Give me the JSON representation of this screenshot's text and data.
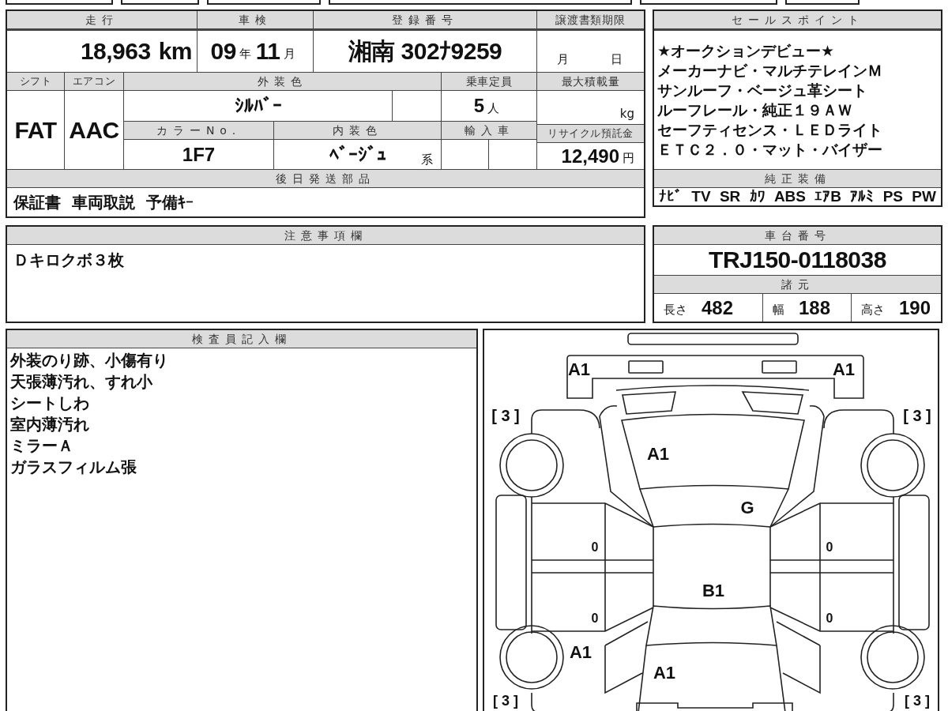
{
  "mileage": {
    "label": "走行",
    "value": "18,963",
    "unit": "km"
  },
  "inspection": {
    "label": "車検",
    "year": "09",
    "year_unit": "年",
    "month": "11",
    "month_unit": "月"
  },
  "registration": {
    "label": "登録番号",
    "value": "湘南 302ﾅ9259"
  },
  "transfer_deadline": {
    "label": "譲渡書類期限",
    "month_unit": "月",
    "day_unit": "日"
  },
  "shift": {
    "label": "シフト",
    "value": "FAT"
  },
  "aircon": {
    "label": "エアコン",
    "value": "AAC"
  },
  "exterior_color": {
    "label": "外装色",
    "value": "ｼﾙﾊﾞｰ"
  },
  "color_no": {
    "label": "カラーNo.",
    "value": "1F7"
  },
  "interior_color": {
    "label": "内装色",
    "value": "ﾍﾞｰｼﾞｭ",
    "suffix": "系"
  },
  "capacity": {
    "label": "乗車定員",
    "value": "5",
    "unit": "人"
  },
  "max_load": {
    "label": "最大積載量",
    "unit": "kg"
  },
  "import": {
    "label": "輸入車"
  },
  "recycle": {
    "label": "リサイクル預託金",
    "value": "12,490",
    "unit": "円"
  },
  "later_parts": {
    "label": "後日発送部品",
    "items": [
      "保証書",
      "車両取説",
      "予備ｷｰ"
    ]
  },
  "sales_points": {
    "label": "セールスポイント",
    "lines": [
      "★オークションデビュー★",
      "メーカーナビ・マルチテレインＭ",
      "サンルーフ・ベージュ革シート",
      "ルーフレール・純正１９ＡＷ",
      "セーフティセンス・ＬＥＤライト",
      "ＥＴＣ２．０・マット・バイザー"
    ]
  },
  "genuine_equipment": {
    "label": "純正装備",
    "items": [
      "ﾅﾋﾞ",
      "TV",
      "SR",
      "ｶﾜ",
      "ABS",
      "ｴｱB",
      "ｱﾙﾐ",
      "PS",
      "PW"
    ]
  },
  "notes": {
    "label": "注意事項欄",
    "text": "Ｄキロクボ３枚"
  },
  "chassis": {
    "label": "車台番号",
    "value": "TRJ150-0118038"
  },
  "specs": {
    "label": "諸元",
    "items": [
      {
        "label": "長さ",
        "value": "482"
      },
      {
        "label": "幅",
        "value": "188"
      },
      {
        "label": "高さ",
        "value": "190"
      }
    ]
  },
  "inspector": {
    "label": "検査員記入欄",
    "lines": [
      "外装のり跡、小傷有り",
      "天張薄汚れ、すれ小",
      "シートしわ",
      "室内薄汚れ",
      "ミラーＡ",
      "ガラスフィルム張"
    ]
  },
  "diagram": {
    "marks": [
      {
        "text": "A1"
      },
      {
        "text": "A1"
      },
      {
        "text": "[ 3 ]"
      },
      {
        "text": "[ 3 ]"
      },
      {
        "text": "A1"
      },
      {
        "text": "G"
      },
      {
        "text": "0"
      },
      {
        "text": "0"
      },
      {
        "text": "B1"
      },
      {
        "text": "0"
      },
      {
        "text": "0"
      },
      {
        "text": "A1"
      },
      {
        "text": "A1"
      },
      {
        "text": "[ 3 ]"
      },
      {
        "text": "[ 3 ]"
      }
    ]
  }
}
